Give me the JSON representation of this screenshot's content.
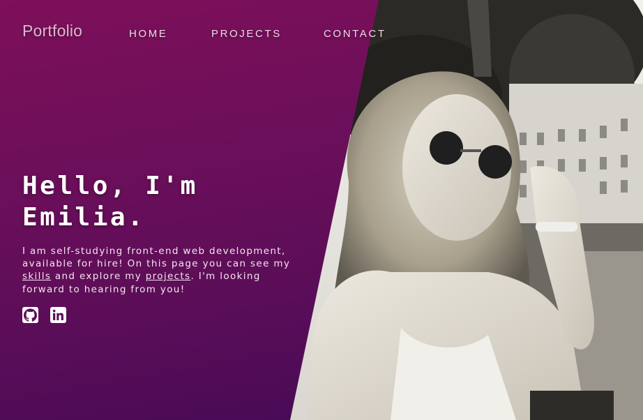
{
  "nav": {
    "brand": "Portfolio",
    "links": [
      "HOME",
      "PROJECTS",
      "CONTACT"
    ]
  },
  "hero": {
    "title_line1": "Hello, I'm",
    "title_line2": "Emilia.",
    "intro_before_skills": "I am self-studying front-end web development, available for hire! On this page you can see my ",
    "skills_link": "skills",
    "intro_between": " and explore my ",
    "projects_link": "projects",
    "intro_after": ". I'm looking forward to hearing from you!"
  },
  "socials": [
    {
      "icon": "github-icon"
    },
    {
      "icon": "linkedin-icon"
    }
  ],
  "colors": {
    "gradient_top": "#7e0f5a",
    "gradient_bottom": "#420a55",
    "text": "#ffffff"
  }
}
